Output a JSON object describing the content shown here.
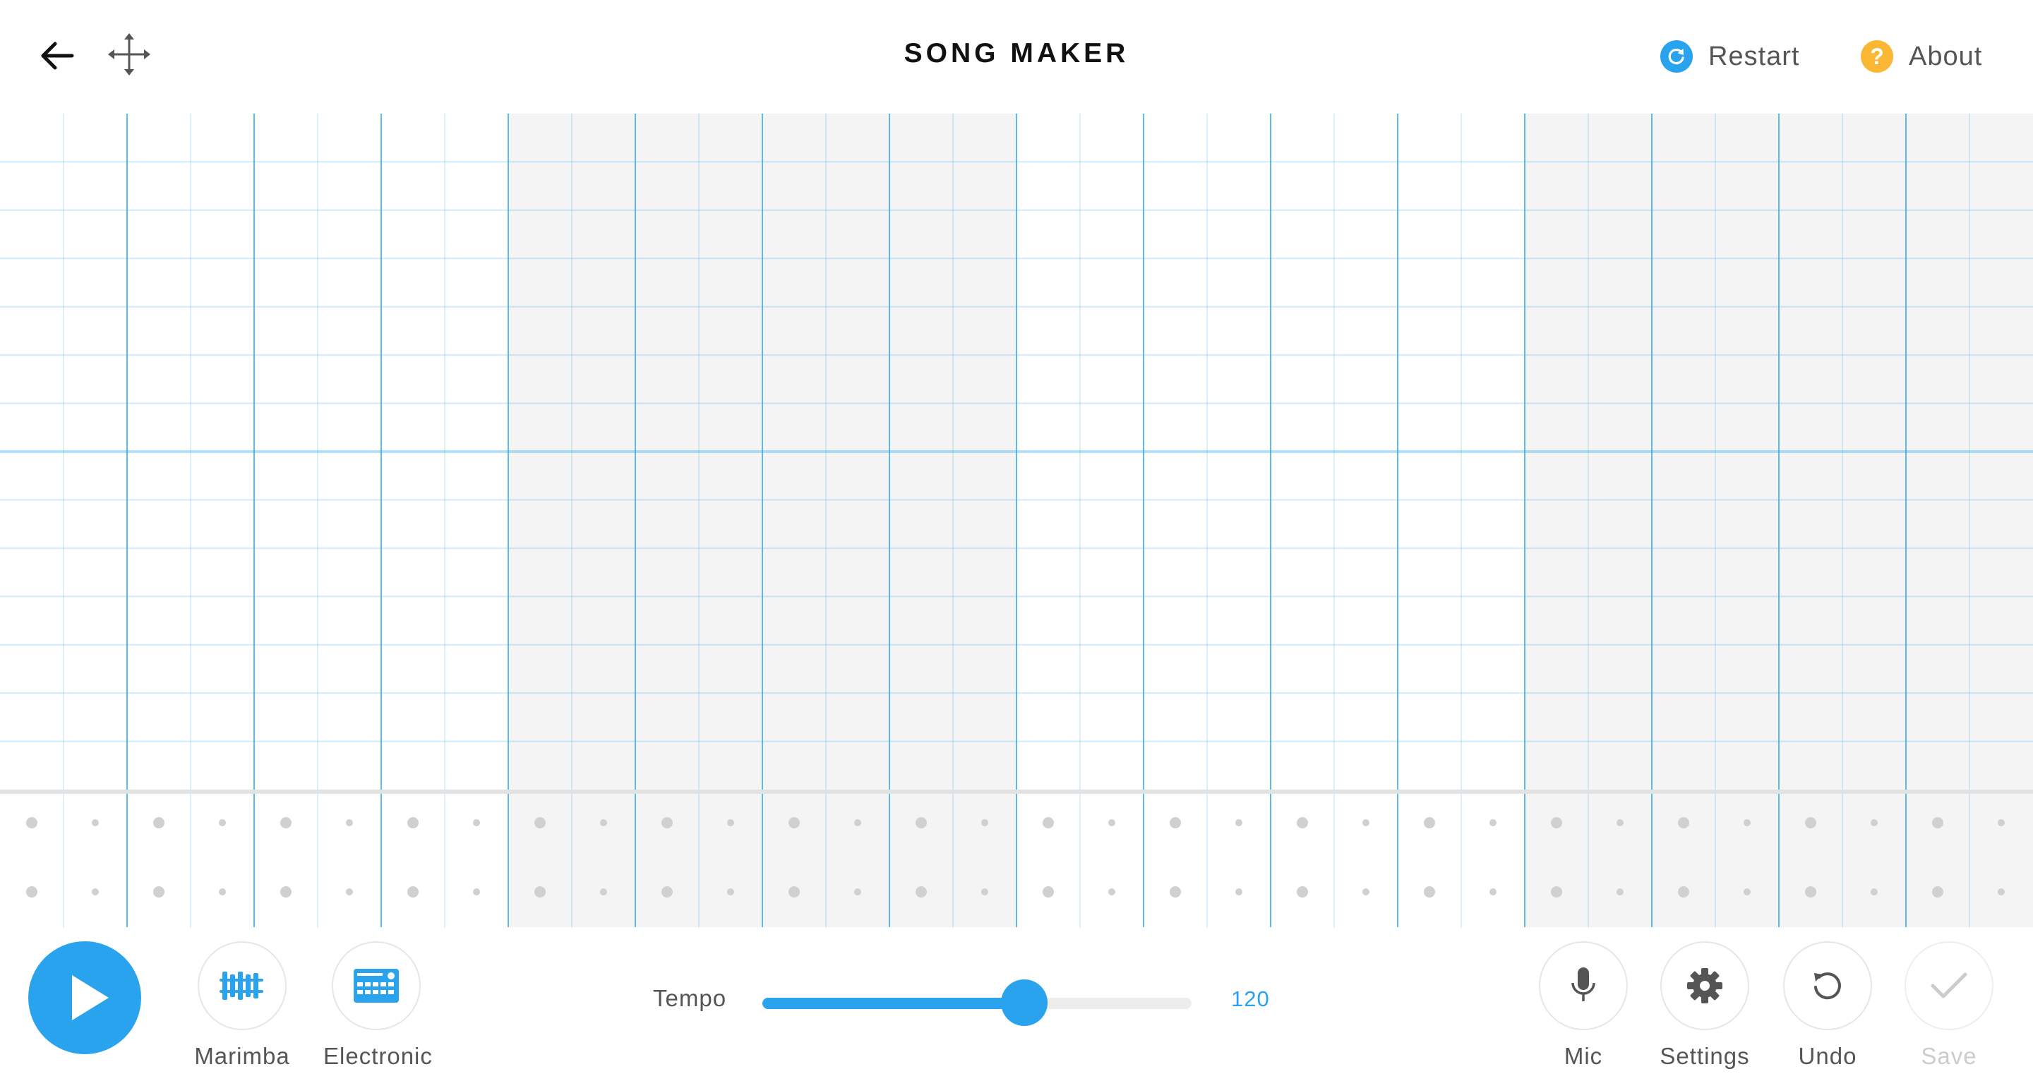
{
  "header": {
    "title": "SONG MAKER",
    "back_icon": "arrow-left-icon",
    "move_icon": "move-arrows-icon",
    "restart_label": "Restart",
    "about_label": "About",
    "restart_color": "#29a3ee",
    "about_color": "#f9b733"
  },
  "grid": {
    "columns": 32,
    "melody_rows": 14,
    "rhythm_rows": 2,
    "line_color": "#29a3ee",
    "shade_color": "#f4f4f4"
  },
  "bottom": {
    "play_icon": "play-icon",
    "instruments": [
      {
        "label": "Marimba",
        "icon": "marimba-icon"
      },
      {
        "label": "Electronic",
        "icon": "drum-machine-icon"
      }
    ],
    "tempo": {
      "label": "Tempo",
      "value": "120",
      "level": 0.61
    },
    "actions": [
      {
        "label": "Mic",
        "icon": "microphone-icon"
      },
      {
        "label": "Settings",
        "icon": "gear-icon"
      },
      {
        "label": "Undo",
        "icon": "undo-icon"
      },
      {
        "label": "Save",
        "icon": "checkmark-icon"
      }
    ],
    "accent": "#29a3ee"
  }
}
